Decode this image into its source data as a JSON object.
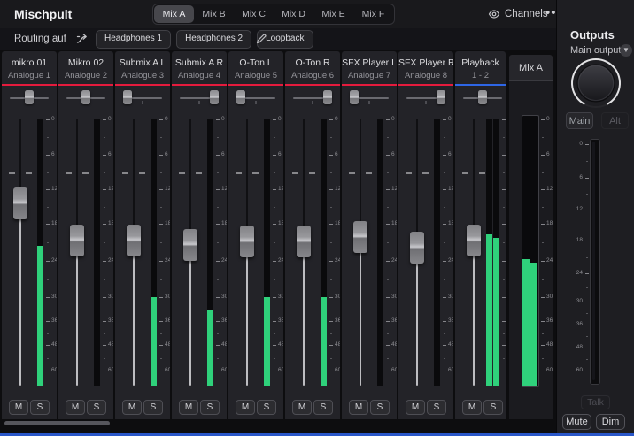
{
  "colors": {
    "meter_green": "#2fd17b",
    "analogue_accent": "#e51b3d",
    "playback_accent": "#2e66e6",
    "bottom_line": "#2a57c9"
  },
  "header": {
    "title": "Mischpult",
    "tabs": [
      "Mix A",
      "Mix B",
      "Mix C",
      "Mix D",
      "Mix E",
      "Mix F"
    ],
    "active_tab": "Mix A",
    "channels_button": "Channels",
    "icons": {
      "channels": "eye-icon",
      "menu": "ellipsis-icon"
    }
  },
  "routing": {
    "label": "Routing auf",
    "destinations": [
      "Headphones 1",
      "Headphones 2",
      "Loopback"
    ],
    "icons": {
      "route": "route-icon",
      "edit": "pencil-icon"
    }
  },
  "meter_scale_labels": [
    "0",
    "6",
    "12",
    "18",
    "24",
    "30",
    "36",
    "48",
    "60"
  ],
  "channel_buttons": {
    "mute": "M",
    "solo": "S"
  },
  "channels": [
    {
      "name": "mikro 01",
      "sub": "Analogue 1",
      "accent": "analogue_accent",
      "pan": 0,
      "fader_pos": 0.319,
      "meter_db": [
        -21.5
      ]
    },
    {
      "name": "Mikro 02",
      "sub": "Analogue 2",
      "accent": "analogue_accent",
      "pan": 0,
      "fader_pos": 0.457,
      "meter_db": [
        null
      ]
    },
    {
      "name": "Submix A L",
      "sub": "Analogue 3",
      "accent": "analogue_accent",
      "pan": -1,
      "fader_pos": 0.457,
      "meter_db": [
        -30
      ]
    },
    {
      "name": "Submix A R",
      "sub": "Analogue 4",
      "accent": "analogue_accent",
      "pan": 1,
      "fader_pos": 0.474,
      "meter_db": [
        -33
      ]
    },
    {
      "name": "O-Ton L",
      "sub": "Analogue 5",
      "accent": "analogue_accent",
      "pan": -1,
      "fader_pos": 0.461,
      "meter_db": [
        -30
      ]
    },
    {
      "name": "O-Ton R",
      "sub": "Analogue 6",
      "accent": "analogue_accent",
      "pan": 1,
      "fader_pos": 0.461,
      "meter_db": [
        -30
      ]
    },
    {
      "name": "SFX Player L",
      "sub": "Analogue 7",
      "accent": "analogue_accent",
      "pan": -1,
      "fader_pos": 0.444,
      "meter_db": [
        null
      ]
    },
    {
      "name": "SFX Player R",
      "sub": "Analogue 8",
      "accent": "analogue_accent",
      "pan": 1,
      "fader_pos": 0.484,
      "meter_db": [
        null
      ]
    },
    {
      "name": "Playback",
      "sub": "1 - 2",
      "accent": "playback_accent",
      "pan": 0,
      "fader_pos": 0.457,
      "meter_db": [
        -19.7,
        -20.3
      ]
    }
  ],
  "master": {
    "name": "Mix A",
    "meter_db": [
      -23.7,
      -24.3
    ]
  },
  "outputs": {
    "title": "Outputs",
    "selected_output": "Main outputs",
    "icons": {
      "selector": "chevron-down-icon",
      "level": "knob"
    },
    "buttons": {
      "main": "Main",
      "alt": "Alt",
      "talk": "Talk",
      "mute": "Mute",
      "dim": "Dim"
    }
  }
}
